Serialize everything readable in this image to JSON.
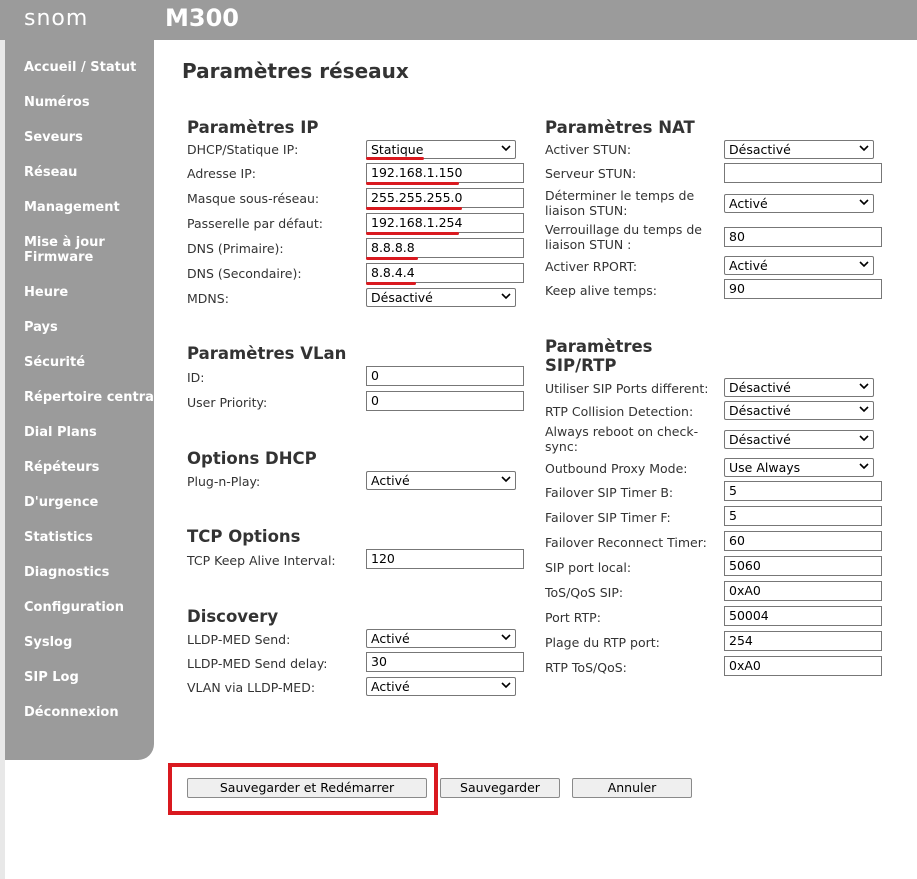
{
  "header": {
    "logo": "snom",
    "model": "M300"
  },
  "sidebar": {
    "items": [
      {
        "label": "Accueil / Statut"
      },
      {
        "label": "Numéros"
      },
      {
        "label": "Seveurs"
      },
      {
        "label": "Réseau"
      },
      {
        "label": "Management"
      },
      {
        "label": "Mise à jour\nFirmware"
      },
      {
        "label": "Heure"
      },
      {
        "label": "Pays"
      },
      {
        "label": "Sécurité"
      },
      {
        "label": "Répertoire central"
      },
      {
        "label": "Dial Plans"
      },
      {
        "label": "Répéteurs"
      },
      {
        "label": "D'urgence"
      },
      {
        "label": "Statistics"
      },
      {
        "label": "Diagnostics"
      },
      {
        "label": "Configuration"
      },
      {
        "label": "Syslog"
      },
      {
        "label": "SIP Log"
      },
      {
        "label": "Déconnexion"
      }
    ]
  },
  "page": {
    "title": "Paramètres réseaux"
  },
  "ip": {
    "title": "Paramètres IP",
    "dhcp_label": "DHCP/Statique IP:",
    "dhcp_value": "Statique",
    "ip_label": "Adresse IP:",
    "ip_value": "192.168.1.150",
    "mask_label": "Masque sous-réseau:",
    "mask_value": "255.255.255.0",
    "gw_label": "Passerelle par défaut:",
    "gw_value": "192.168.1.254",
    "dns1_label": "DNS (Primaire):",
    "dns1_value": "8.8.8.8",
    "dns2_label": "DNS (Secondaire):",
    "dns2_value": "8.8.4.4",
    "mdns_label": "MDNS:",
    "mdns_value": "Désactivé"
  },
  "vlan": {
    "title": "Paramètres VLan",
    "id_label": "ID:",
    "id_value": "0",
    "prio_label": "User Priority:",
    "prio_value": "0"
  },
  "dhcp_options": {
    "title": "Options DHCP",
    "pnp_label": "Plug-n-Play:",
    "pnp_value": "Activé"
  },
  "tcp": {
    "title": "TCP Options",
    "keepalive_label": "TCP Keep Alive Interval:",
    "keepalive_value": "120"
  },
  "discovery": {
    "title": "Discovery",
    "lldp_send_label": "LLDP-MED Send:",
    "lldp_send_value": "Activé",
    "lldp_delay_label": "LLDP-MED Send delay:",
    "lldp_delay_value": "30",
    "vlan_lldp_label": "VLAN via LLDP-MED:",
    "vlan_lldp_value": "Activé"
  },
  "nat": {
    "title": "Paramètres NAT",
    "stun_enable_label": "Activer STUN:",
    "stun_enable_value": "Désactivé",
    "stun_server_label": "Serveur STUN:",
    "stun_server_value": "",
    "stun_binding_label": "Déterminer le temps de\nliaison STUN:",
    "stun_binding_value": "Activé",
    "stun_lock_label": "Verrouillage du temps de\nliaison STUN :",
    "stun_lock_value": "80",
    "rport_label": "Activer RPORT:",
    "rport_value": "Activé",
    "keepalive_label": "Keep alive temps:",
    "keepalive_value": "90"
  },
  "sip": {
    "title": "Paramètres\nSIP/RTP",
    "diff_ports_label": "Utiliser SIP Ports different:",
    "diff_ports_value": "Désactivé",
    "rtp_collision_label": "RTP Collision Detection:",
    "rtp_collision_value": "Désactivé",
    "reboot_label": "Always reboot on check-\nsync:",
    "reboot_value": "Désactivé",
    "outbound_label": "Outbound Proxy Mode:",
    "outbound_value": "Use Always",
    "timer_b_label": "Failover SIP Timer B:",
    "timer_b_value": "5",
    "timer_f_label": "Failover SIP Timer F:",
    "timer_f_value": "5",
    "reconnect_label": "Failover Reconnect Timer:",
    "reconnect_value": "60",
    "port_local_label": "SIP port local:",
    "port_local_value": "5060",
    "tos_sip_label": "ToS/QoS SIP:",
    "tos_sip_value": "0xA0",
    "rtp_port_label": "Port RTP:",
    "rtp_port_value": "50004",
    "rtp_range_label": "Plage du RTP port:",
    "rtp_range_value": "254",
    "rtp_tos_label": "RTP ToS/QoS:",
    "rtp_tos_value": "0xA0"
  },
  "buttons": {
    "save_restart": "Sauvegarder et Redémarrer",
    "save": "Sauvegarder",
    "cancel": "Annuler"
  },
  "colors": {
    "sidebar": "#9b9b9b",
    "highlight": "#d9191f"
  },
  "icons": {
    "select_arrow": "chevron-down-icon"
  }
}
